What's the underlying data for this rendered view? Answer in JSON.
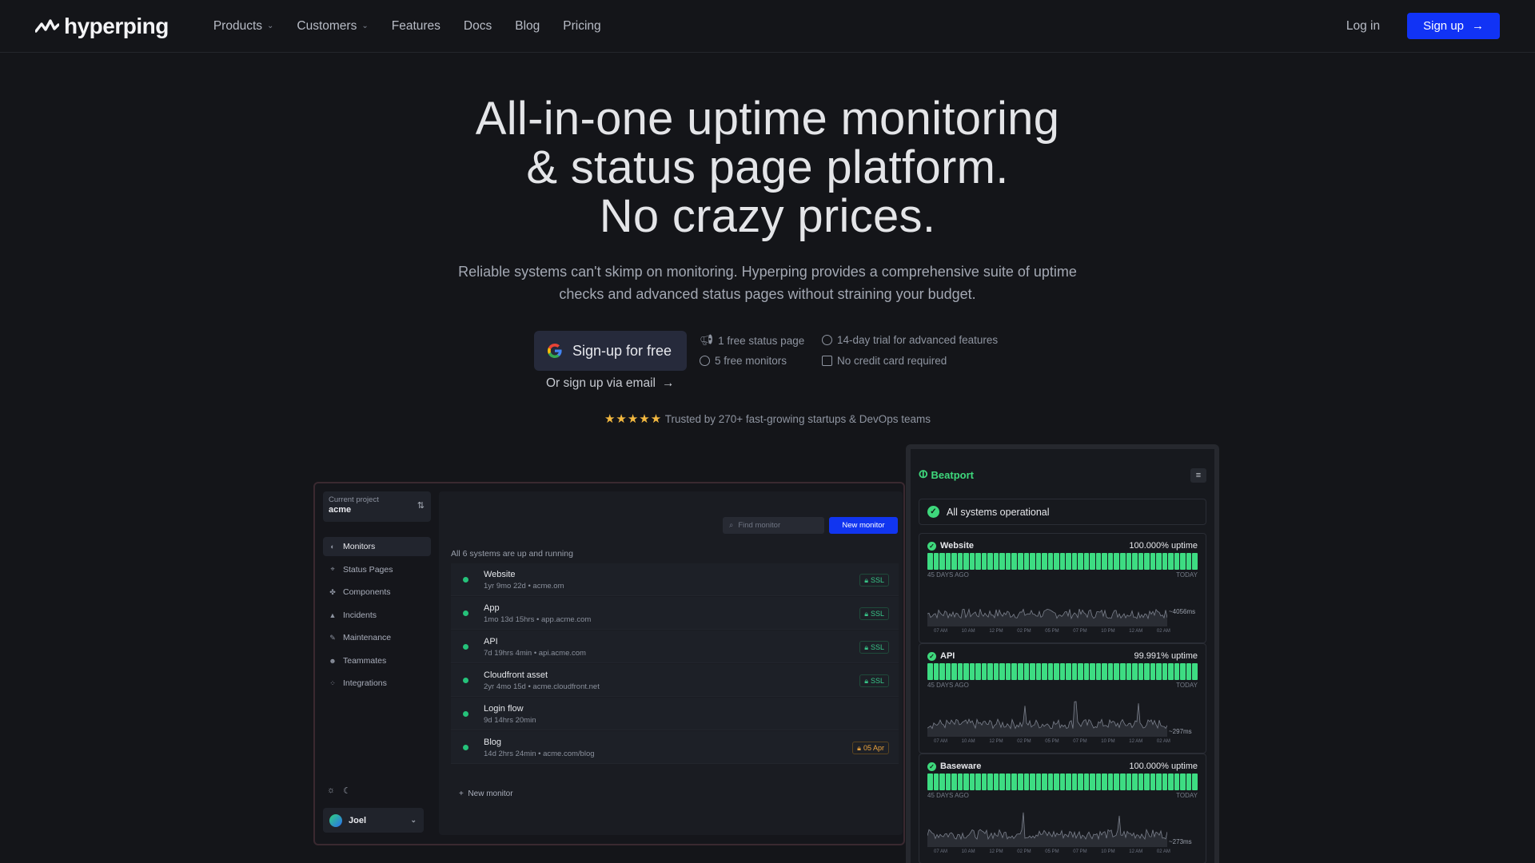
{
  "nav": {
    "brand": "hyperping",
    "menu": [
      {
        "label": "Products",
        "has_dropdown": true
      },
      {
        "label": "Customers",
        "has_dropdown": true
      },
      {
        "label": "Features"
      },
      {
        "label": "Docs"
      },
      {
        "label": "Blog"
      },
      {
        "label": "Pricing"
      }
    ],
    "login": "Log in",
    "signup": "Sign up"
  },
  "hero": {
    "title_line1": "All-in-one uptime monitoring",
    "title_line2": "& status page platform.",
    "title_line3": "No crazy prices.",
    "subtitle": "Reliable systems can't skimp on monitoring. Hyperping provides a comprehensive suite of uptime checks and advanced status pages without straining your budget.",
    "google_cta": "Sign-up for free",
    "email_cta": "Or sign up via email",
    "features": [
      "1 free status page",
      "5 free monitors",
      "14-day trial for advanced features",
      "No credit card required"
    ],
    "trust": "Trusted by 270+ fast-growing startups & DevOps teams",
    "stars": 5
  },
  "dashboard": {
    "project_label": "Current project",
    "project_name": "acme",
    "sidebar": [
      "Monitors",
      "Status Pages",
      "Components",
      "Incidents",
      "Maintenance",
      "Teammates",
      "Integrations"
    ],
    "active_item": "Monitors",
    "user": "Joel",
    "search_placeholder": "Find monitor",
    "new_monitor": "New monitor",
    "summary": "All 6 systems are up and running",
    "monitors": [
      {
        "name": "Website",
        "meta": "1yr 9mo 22d • acme.om",
        "badge": "SSL",
        "badge_type": "ssl"
      },
      {
        "name": "App",
        "meta": "1mo 13d 15hrs • app.acme.com",
        "badge": "SSL",
        "badge_type": "ssl"
      },
      {
        "name": "API",
        "meta": "7d 19hrs 4min • api.acme.com",
        "badge": "SSL",
        "badge_type": "ssl"
      },
      {
        "name": "Cloudfront asset",
        "meta": "2yr 4mo 15d • acme.cloudfront.net",
        "badge": "SSL",
        "badge_type": "ssl"
      },
      {
        "name": "Login flow",
        "meta": "9d 14hrs 20min",
        "badge": "",
        "badge_type": "none"
      },
      {
        "name": "Blog",
        "meta": "14d 2hrs 24min • acme.com/blog",
        "badge": "05 Apr",
        "badge_type": "exp"
      }
    ],
    "add_monitor": "New monitor"
  },
  "status_page": {
    "brand": "Beatport",
    "overall": "All systems operational",
    "services": [
      {
        "name": "Website",
        "uptime": "100.000% uptime",
        "response": "~4056ms"
      },
      {
        "name": "API",
        "uptime": "99.991% uptime",
        "response": "~297ms"
      },
      {
        "name": "Baseware",
        "uptime": "100.000% uptime",
        "response": "~273ms"
      }
    ],
    "range_start": "45 DAYS AGO",
    "range_end": "TODAY",
    "time_ticks": [
      "07 AM",
      "10 AM",
      "12 PM",
      "02 PM",
      "05 PM",
      "07 PM",
      "10 PM",
      "12 AM",
      "02 AM"
    ],
    "bar_color": "#3ddc82"
  },
  "colors": {
    "accent": "#1133f5",
    "success": "#3ed87c",
    "warning": "#e9a23d"
  }
}
